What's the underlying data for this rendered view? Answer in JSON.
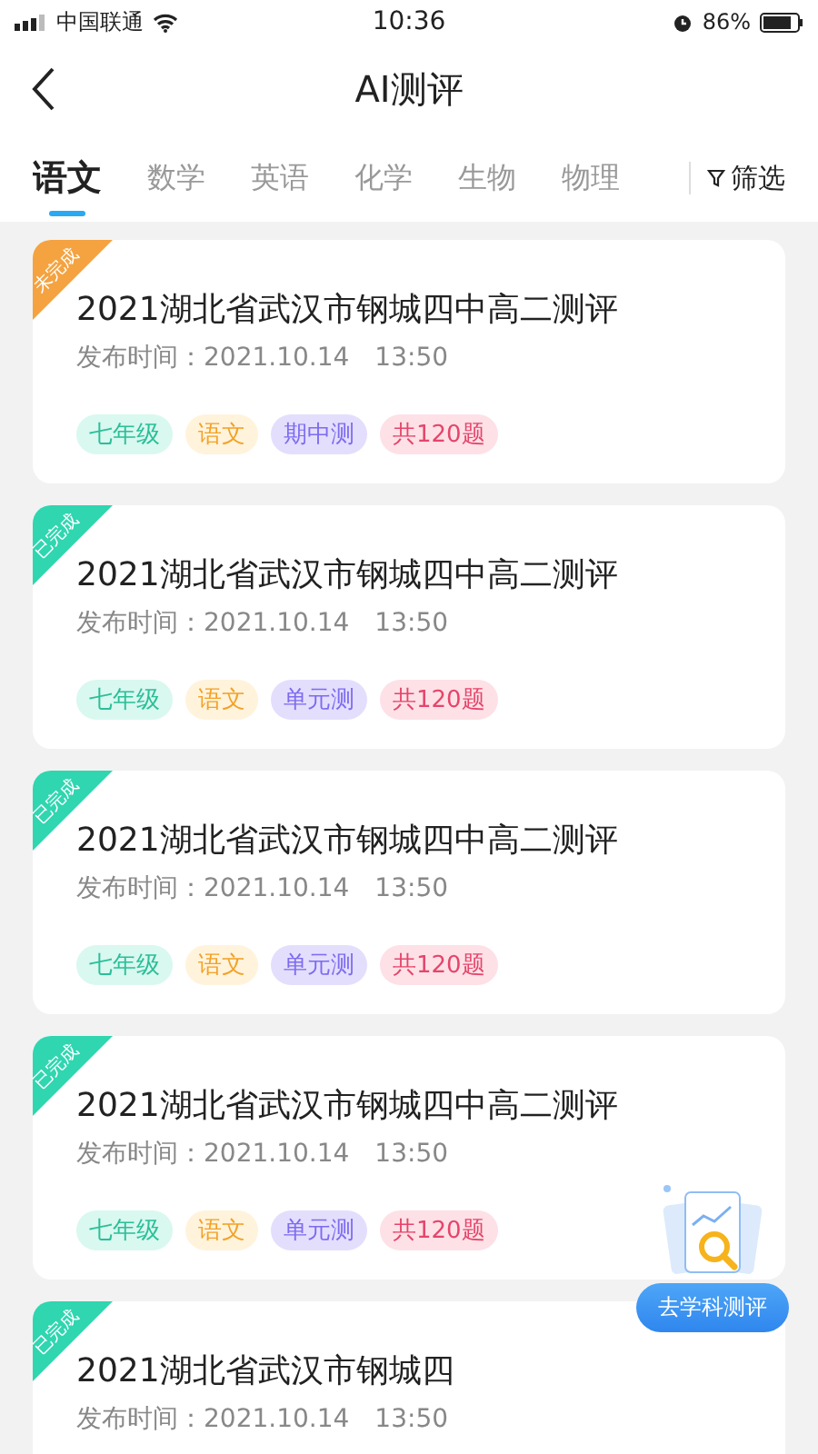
{
  "status_bar": {
    "carrier": "中国联通",
    "time": "10:36",
    "battery": "86%"
  },
  "nav": {
    "title": "AI测评"
  },
  "tabs": [
    {
      "label": "语文",
      "selected": true
    },
    {
      "label": "数学",
      "selected": false
    },
    {
      "label": "英语",
      "selected": false
    },
    {
      "label": "化学",
      "selected": false
    },
    {
      "label": "生物",
      "selected": false
    },
    {
      "label": "物理",
      "selected": false
    }
  ],
  "filter": {
    "label": "筛选"
  },
  "cards": [
    {
      "ribbon": {
        "text": "未完成",
        "kind": "incomplete"
      },
      "title": "2021湖北省武汉市钢城四中高二测评",
      "published": "发布时间：2021.10.14　13:50",
      "tags": [
        {
          "text": "七年级",
          "kind": "grade"
        },
        {
          "text": "语文",
          "kind": "subject"
        },
        {
          "text": "期中测",
          "kind": "exam"
        },
        {
          "text": "共120题",
          "kind": "count"
        }
      ]
    },
    {
      "ribbon": {
        "text": "已完成",
        "kind": "complete"
      },
      "title": "2021湖北省武汉市钢城四中高二测评",
      "published": "发布时间：2021.10.14　13:50",
      "tags": [
        {
          "text": "七年级",
          "kind": "grade"
        },
        {
          "text": "语文",
          "kind": "subject"
        },
        {
          "text": "单元测",
          "kind": "exam"
        },
        {
          "text": "共120题",
          "kind": "count"
        }
      ]
    },
    {
      "ribbon": {
        "text": "已完成",
        "kind": "complete"
      },
      "title": "2021湖北省武汉市钢城四中高二测评",
      "published": "发布时间：2021.10.14　13:50",
      "tags": [
        {
          "text": "七年级",
          "kind": "grade"
        },
        {
          "text": "语文",
          "kind": "subject"
        },
        {
          "text": "单元测",
          "kind": "exam"
        },
        {
          "text": "共120题",
          "kind": "count"
        }
      ]
    },
    {
      "ribbon": {
        "text": "已完成",
        "kind": "complete"
      },
      "title": "2021湖北省武汉市钢城四中高二测评",
      "published": "发布时间：2021.10.14　13:50",
      "tags": [
        {
          "text": "七年级",
          "kind": "grade"
        },
        {
          "text": "语文",
          "kind": "subject"
        },
        {
          "text": "单元测",
          "kind": "exam"
        },
        {
          "text": "共120题",
          "kind": "count"
        }
      ]
    },
    {
      "ribbon": {
        "text": "已完成",
        "kind": "complete"
      },
      "title": "2021湖北省武汉市钢城四",
      "published": "发布时间：2021.10.14　13:50"
    }
  ],
  "fab": {
    "label": "去学科测评"
  }
}
